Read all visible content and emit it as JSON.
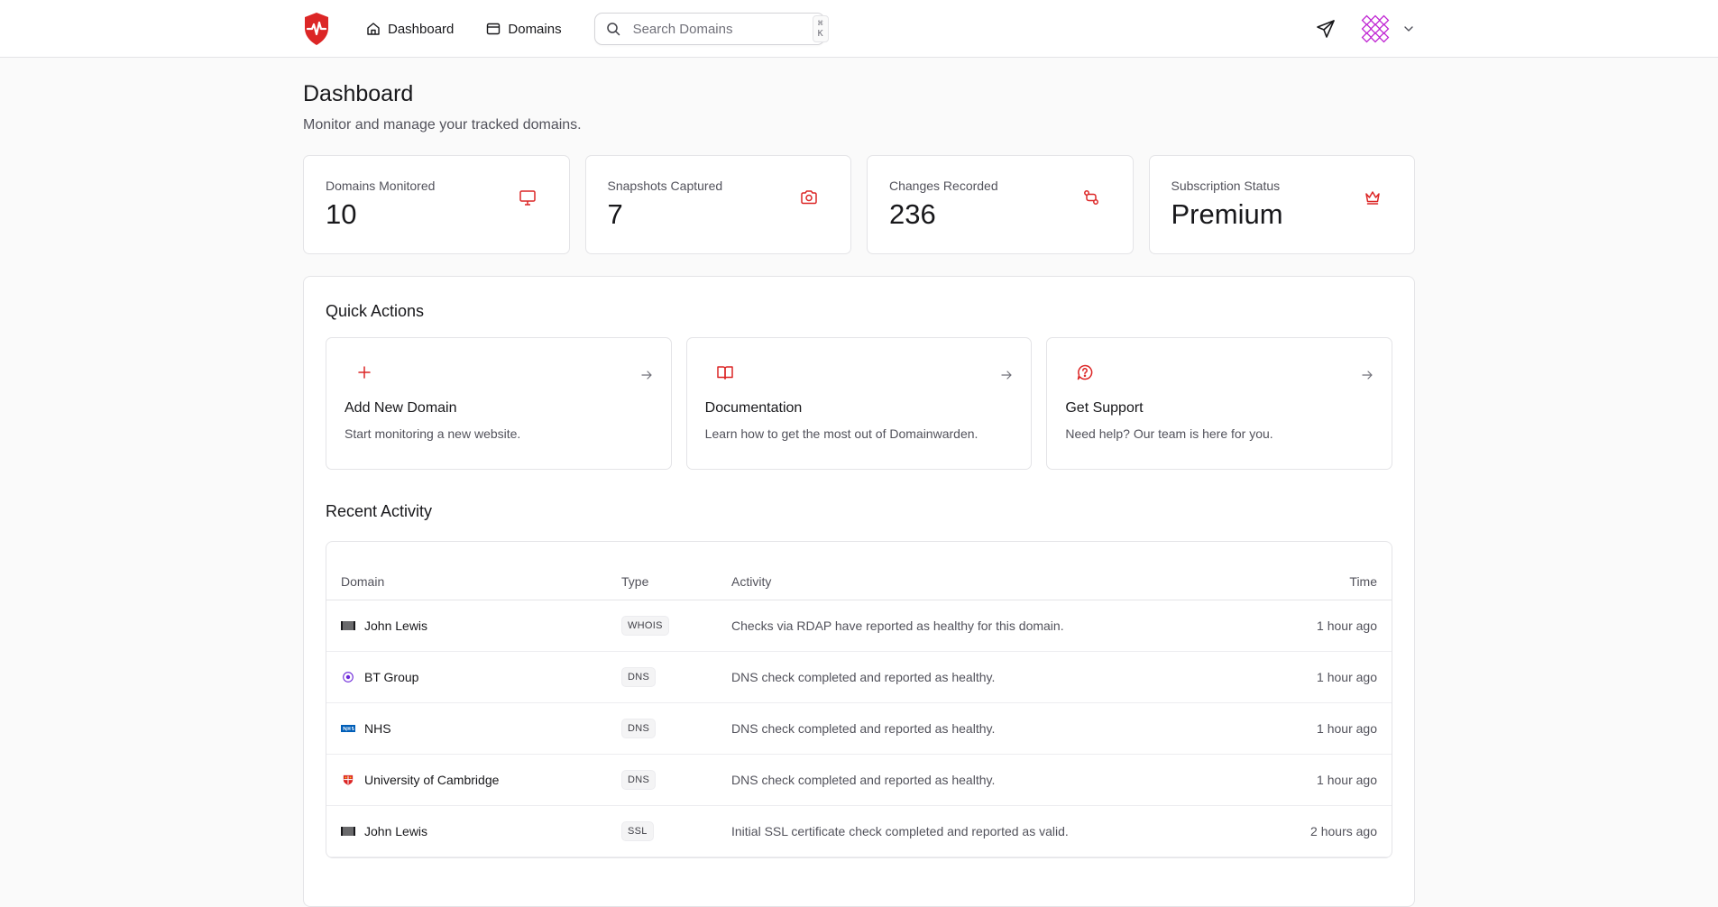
{
  "nav": {
    "items": [
      {
        "label": "Dashboard",
        "icon": "home-icon"
      },
      {
        "label": "Domains",
        "icon": "browser-window-icon"
      }
    ],
    "search": {
      "placeholder": "Search Domains",
      "shortcut": "⌘ K"
    }
  },
  "page": {
    "title": "Dashboard",
    "subtitle": "Monitor and manage your tracked domains."
  },
  "stats": [
    {
      "label": "Domains Monitored",
      "value": "10",
      "icon": "monitor-icon"
    },
    {
      "label": "Snapshots Captured",
      "value": "7",
      "icon": "camera-icon"
    },
    {
      "label": "Changes Recorded",
      "value": "236",
      "icon": "git-compare-icon"
    },
    {
      "label": "Subscription Status",
      "value": "Premium",
      "icon": "crown-icon"
    }
  ],
  "quick_actions": {
    "title": "Quick Actions",
    "items": [
      {
        "title": "Add New Domain",
        "description": "Start monitoring a new website.",
        "icon": "plus-icon"
      },
      {
        "title": "Documentation",
        "description": "Learn how to get the most out of Domainwarden.",
        "icon": "book-open-icon"
      },
      {
        "title": "Get Support",
        "description": "Need help? Our team is here for you.",
        "icon": "help-bubble-icon"
      }
    ]
  },
  "activity": {
    "title": "Recent Activity",
    "columns": {
      "domain": "Domain",
      "type": "Type",
      "activity": "Activity",
      "time": "Time"
    },
    "rows": [
      {
        "domain": "John Lewis",
        "type": "WHOIS",
        "activity": "Checks via RDAP have reported as healthy for this domain.",
        "time": "1 hour ago"
      },
      {
        "domain": "BT Group",
        "type": "DNS",
        "activity": "DNS check completed and reported as healthy.",
        "time": "1 hour ago"
      },
      {
        "domain": "NHS",
        "type": "DNS",
        "activity": "DNS check completed and reported as healthy.",
        "time": "1 hour ago"
      },
      {
        "domain": "University of Cambridge",
        "type": "DNS",
        "activity": "DNS check completed and reported as healthy.",
        "time": "1 hour ago"
      },
      {
        "domain": "John Lewis",
        "type": "SSL",
        "activity": "Initial SSL certificate check completed and reported as valid.",
        "time": "2 hours ago"
      }
    ]
  },
  "colors": {
    "accent": "#dc2626",
    "border": "#e4e4e7",
    "muted_text": "#52525b"
  }
}
